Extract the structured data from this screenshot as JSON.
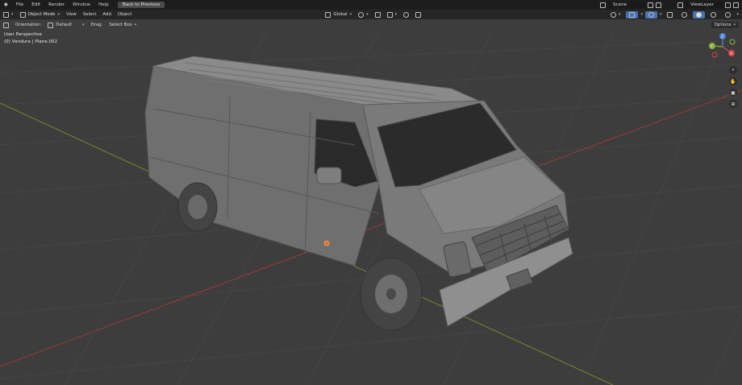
{
  "menu": {
    "logo": "blender-logo",
    "items": [
      "File",
      "Edit",
      "Render",
      "Window",
      "Help"
    ],
    "back": "Back to Previous"
  },
  "workspace": {
    "scene_label": "Scene",
    "viewlayer_label": "ViewLayer"
  },
  "header": {
    "mode": "Object Mode",
    "menus": [
      "View",
      "Select",
      "Add",
      "Object"
    ],
    "orientation": "Global"
  },
  "tool": {
    "orientation_label": "Orientation:",
    "orientation_value": "Default",
    "drag_label": "Drag:",
    "drag_value": "Select Box",
    "options": "Options"
  },
  "viewport": {
    "perspective": "User Perspective",
    "object_info": "(0) Vandura | Plane.002"
  },
  "gizmo": {
    "z": "Z",
    "y": "Y",
    "x": "X"
  },
  "colors": {
    "bg": "#3d3d3d",
    "grid": "#474747",
    "x_axis": "#9b3a3a",
    "y_axis": "#6f8a2e",
    "accent": "#4772b3"
  }
}
